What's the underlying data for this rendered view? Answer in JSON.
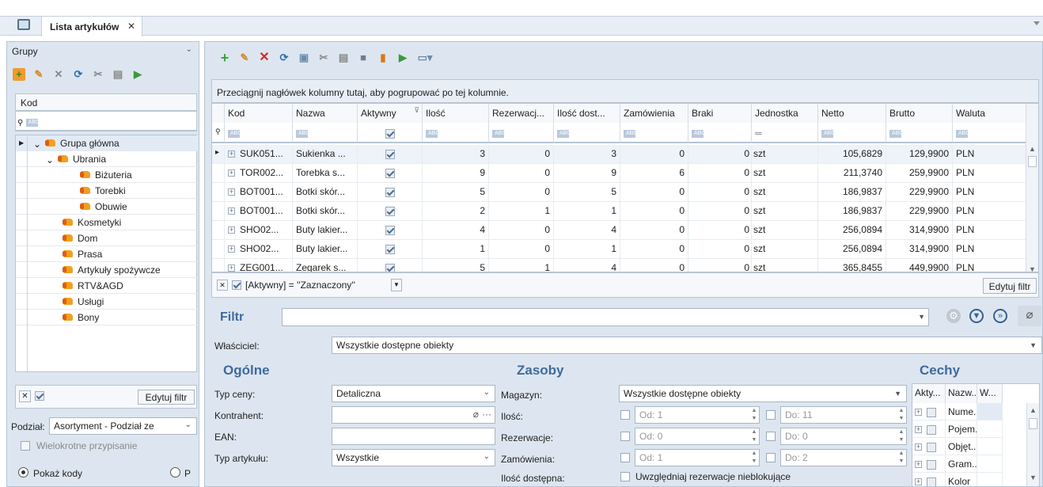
{
  "window": {
    "tab_title": "Lista artykułów",
    "tab_close": "✕"
  },
  "groups": {
    "title": "Grupy",
    "col_kod": "Kod",
    "tree": [
      {
        "label": "Grupa główna",
        "level": 0
      },
      {
        "label": "Ubrania",
        "level": 1
      },
      {
        "label": "Biżuteria",
        "level": 2
      },
      {
        "label": "Torebki",
        "level": 2
      },
      {
        "label": "Obuwie",
        "level": 2
      },
      {
        "label": "Kosmetyki",
        "level": 1
      },
      {
        "label": "Dom",
        "level": 1
      },
      {
        "label": "Prasa",
        "level": 1
      },
      {
        "label": "Artykuły spożywcze",
        "level": 1
      },
      {
        "label": "RTV&AGD",
        "level": 1
      },
      {
        "label": "Usługi",
        "level": 1
      },
      {
        "label": "Bony",
        "level": 1
      }
    ],
    "edit_filter": "Edytuj filtr",
    "podzial_label": "Podział:",
    "podzial_value": "Asortyment - Podział ze",
    "wielokrotne": "Wielokrotne przypisanie",
    "pokaz_kody": "Pokaż kody",
    "second_radio": "P"
  },
  "grid": {
    "group_hint": "Przeciągnij nagłówek kolumny tutaj, aby pogrupować po tej kolumnie.",
    "columns": [
      "Kod",
      "Nazwa",
      "Aktywny",
      "Ilość",
      "Rezerwacj...",
      "Ilość dost...",
      "Zamówienia",
      "Braki",
      "Jednostka",
      "Netto",
      "Brutto",
      "Waluta"
    ],
    "rows": [
      {
        "kod": "SUK051...",
        "nazwa": "Sukienka ...",
        "ilosc": "3",
        "rez": "0",
        "dost": "3",
        "zam": "0",
        "braki": "0",
        "jedn": "szt",
        "netto": "105,6829",
        "brutto": "129,9900",
        "waluta": "PLN"
      },
      {
        "kod": "TOR002...",
        "nazwa": "Torebka s...",
        "ilosc": "9",
        "rez": "0",
        "dost": "9",
        "zam": "6",
        "braki": "0",
        "jedn": "szt",
        "netto": "211,3740",
        "brutto": "259,9900",
        "waluta": "PLN"
      },
      {
        "kod": "BOT001...",
        "nazwa": "Botki skór...",
        "ilosc": "5",
        "rez": "0",
        "dost": "5",
        "zam": "0",
        "braki": "0",
        "jedn": "szt",
        "netto": "186,9837",
        "brutto": "229,9900",
        "waluta": "PLN"
      },
      {
        "kod": "BOT001...",
        "nazwa": "Botki skór...",
        "ilosc": "2",
        "rez": "1",
        "dost": "1",
        "zam": "0",
        "braki": "0",
        "jedn": "szt",
        "netto": "186,9837",
        "brutto": "229,9900",
        "waluta": "PLN"
      },
      {
        "kod": "SHO02...",
        "nazwa": "Buty lakier...",
        "ilosc": "4",
        "rez": "0",
        "dost": "4",
        "zam": "0",
        "braki": "0",
        "jedn": "szt",
        "netto": "256,0894",
        "brutto": "314,9900",
        "waluta": "PLN"
      },
      {
        "kod": "SHO02...",
        "nazwa": "Buty lakier...",
        "ilosc": "1",
        "rez": "0",
        "dost": "1",
        "zam": "0",
        "braki": "0",
        "jedn": "szt",
        "netto": "256,0894",
        "brutto": "314,9900",
        "waluta": "PLN"
      },
      {
        "kod": "ZEG001...",
        "nazwa": "Zegarek s...",
        "ilosc": "5",
        "rez": "1",
        "dost": "4",
        "zam": "0",
        "braki": "0",
        "jedn": "szt",
        "netto": "365,8455",
        "brutto": "449,9900",
        "waluta": "PLN"
      }
    ],
    "active_filter": "[Aktywny] = ''Zaznaczony''",
    "edit_filter": "Edytuj filtr"
  },
  "filter": {
    "title": "Filtr",
    "owner_label": "Właściciel:",
    "owner_value": "Wszystkie dostępne obiekty",
    "general": {
      "title": "Ogólne",
      "typ_ceny_label": "Typ ceny:",
      "typ_ceny_value": "Detaliczna",
      "kontrahent_label": "Kontrahent:",
      "ean_label": "EAN:",
      "typ_art_label": "Typ artykułu:",
      "typ_art_value": "Wszystkie"
    },
    "stock": {
      "title": "Zasoby",
      "magazyn_label": "Magazyn:",
      "magazyn_value": "Wszystkie dostępne obiekty",
      "ilosc_label": "Ilość:",
      "rez_label": "Rezerwacje:",
      "zam_label": "Zamówienia:",
      "dost_label": "Ilość dostępna:",
      "od": "Od:",
      "do": "Do:",
      "ilosc_od": "1",
      "ilosc_do": "11",
      "rez_od": "0",
      "rez_do": "0",
      "zam_od": "1",
      "zam_do": "2",
      "uwzgl": "Uwzględniaj rezerwacje nieblokujące"
    },
    "features": {
      "title": "Cechy",
      "cols": [
        "Akty...",
        "Nazw...",
        "W..."
      ],
      "rows": [
        "Nume...",
        "Pojem...",
        "Objęt...",
        "Gram...",
        "Kolor"
      ]
    }
  }
}
